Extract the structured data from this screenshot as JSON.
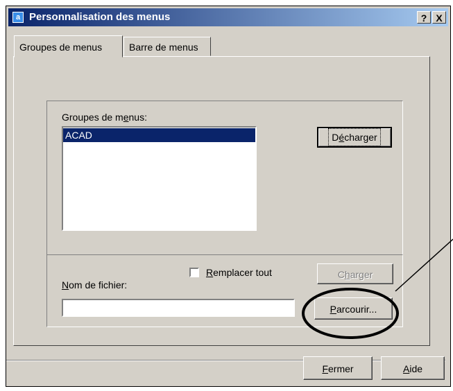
{
  "window": {
    "title": "Personnalisation des menus",
    "help": "?",
    "close": "X"
  },
  "tabs": [
    {
      "label": "Groupes de menus"
    },
    {
      "label": "Barre de menus"
    }
  ],
  "groups": {
    "label_pre": "Groupes de m",
    "label_mn": "e",
    "label_post": "nus:",
    "items": [
      "ACAD"
    ],
    "unload_pre": "D",
    "unload_mn": "é",
    "unload_post": "charger"
  },
  "load": {
    "replace_mn": "R",
    "replace_post": "emplacer tout",
    "load_pre": "C",
    "load_mn": "h",
    "load_post": "arger",
    "file_mn": "N",
    "file_post": "om de fichier:",
    "file_value": "",
    "browse_mn": "P",
    "browse_post": "arcourir..."
  },
  "footer": {
    "close_mn": "F",
    "close_post": "ermer",
    "help_mn": "A",
    "help_post": "ide"
  }
}
